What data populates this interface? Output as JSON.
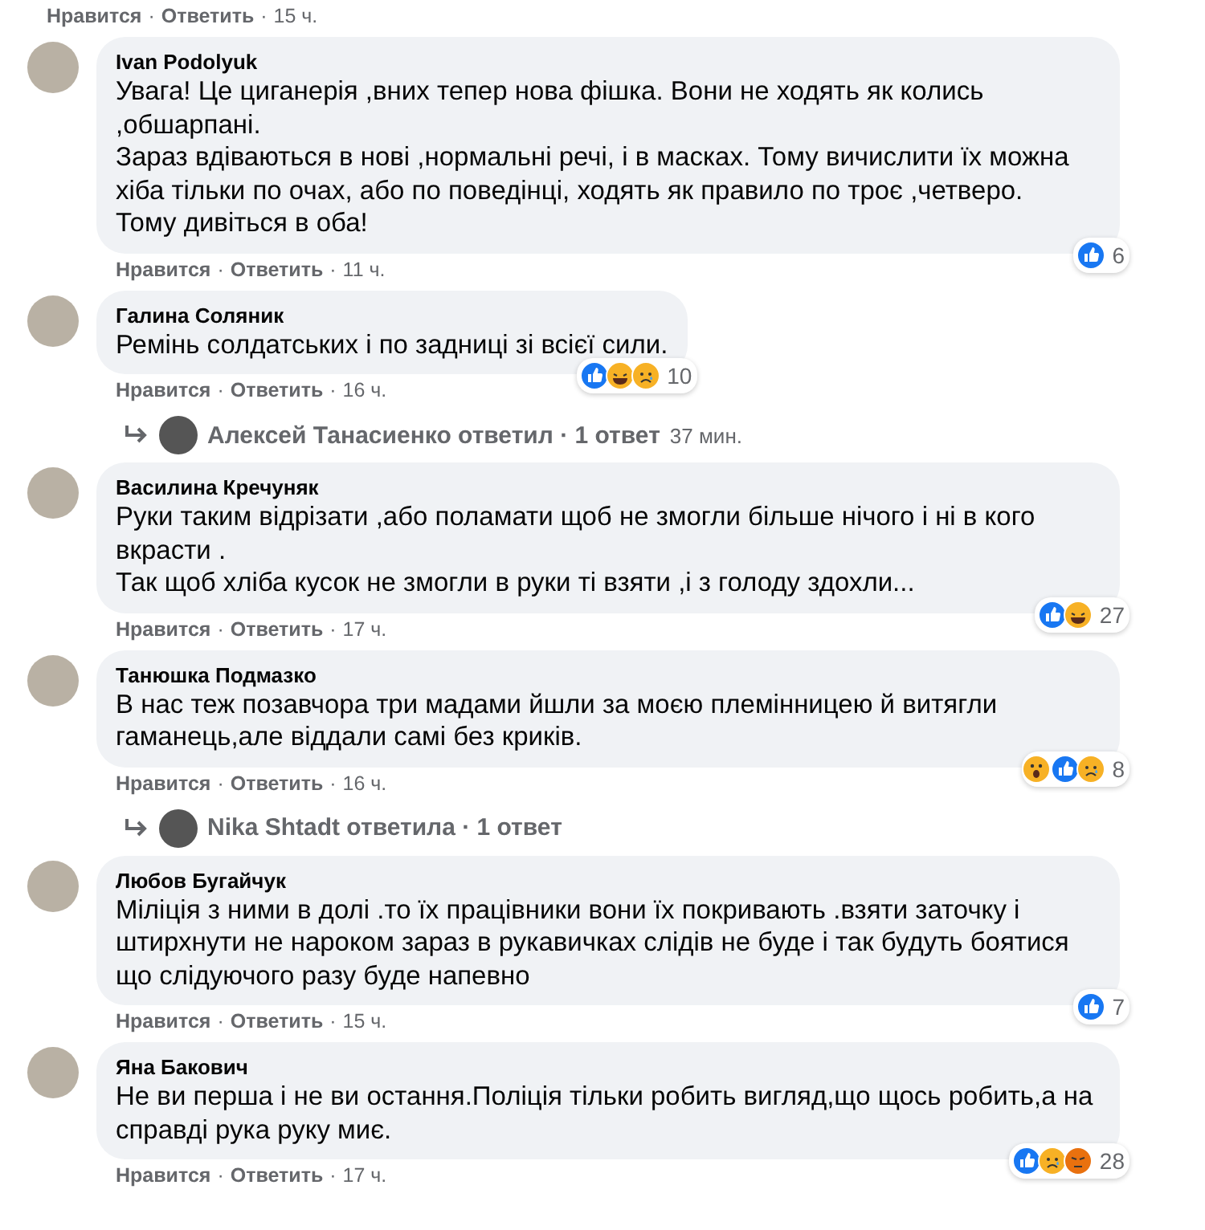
{
  "top_actions": {
    "like": "Нравится",
    "sep1": "·",
    "reply": "Ответить",
    "sep2": "·",
    "time": "15 ч."
  },
  "items": [
    {
      "kind": "comment",
      "author": "Ivan Podolyuk",
      "paragraphs": [
        "Увага! Це циганерія ,вних тепер нова фішка. Вони не ходять як колись ,обшарпані.",
        "Зараз вдіваються в нові ,нормальні речі, і в масках. Тому вичислити їх можна хіба тільки по очах, або по поведінці, ходять як правило по троє ,четверо.",
        "Тому дивіться в оба!"
      ],
      "reactions": [
        {
          "kind": "like"
        }
      ],
      "count": "6",
      "actions": {
        "like": "Нравится",
        "sep1": "·",
        "reply": "Ответить",
        "sep2": "·",
        "time": "11 ч."
      }
    },
    {
      "kind": "comment",
      "author": "Галина Соляник",
      "paragraphs": [
        "Ремінь солдатських і по задниці зі всієї сили."
      ],
      "reactions": [
        {
          "kind": "like"
        },
        {
          "kind": "haha"
        },
        {
          "kind": "sad"
        }
      ],
      "count": "10",
      "actions": {
        "like": "Нравится",
        "sep1": "·",
        "reply": "Ответить",
        "sep2": "·",
        "time": "16 ч."
      }
    },
    {
      "kind": "replies",
      "text": "Алексей Танасиенко ответил · 1 ответ",
      "time": "37 мин."
    },
    {
      "kind": "comment",
      "author": "Василина Кречуняк",
      "paragraphs": [
        "Руки таким відрізати ,або поламати щоб не змогли більше нічого і ні в кого вкрасти .",
        "Так щоб хліба кусок не змогли в руки ті взяти ,і з голоду здохли..."
      ],
      "reactions": [
        {
          "kind": "like"
        },
        {
          "kind": "haha"
        }
      ],
      "count": "27",
      "actions": {
        "like": "Нравится",
        "sep1": "·",
        "reply": "Ответить",
        "sep2": "·",
        "time": "17 ч."
      }
    },
    {
      "kind": "comment",
      "author": "Танюшка Подмазко",
      "paragraphs": [
        "В нас теж позавчора три мадами йшли за моєю племінницею й витягли гаманець,але віддали самі без криків."
      ],
      "reactions": [
        {
          "kind": "wow"
        },
        {
          "kind": "like"
        },
        {
          "kind": "sad"
        }
      ],
      "count": "8",
      "actions": {
        "like": "Нравится",
        "sep1": "·",
        "reply": "Ответить",
        "sep2": "·",
        "time": "16 ч."
      }
    },
    {
      "kind": "replies",
      "text": "Nika Shtadt ответила · 1 ответ"
    },
    {
      "kind": "comment",
      "author": "Любов Бугайчук",
      "paragraphs": [
        "Міліція з ними в долі .то їх працівники вони їх покривають .взяти заточку і штирхнути не нароком зараз в рукавичках слідів не буде і так будуть боятися що слідуючого разу буде напевно"
      ],
      "reactions": [
        {
          "kind": "like"
        }
      ],
      "count": "7",
      "actions": {
        "like": "Нравится",
        "sep1": "·",
        "reply": "Ответить",
        "sep2": "·",
        "time": "15 ч."
      }
    },
    {
      "kind": "comment",
      "author": "Яна Бакович",
      "paragraphs": [
        "Не ви перша і не ви остання.Поліція тільки робить вигляд,що щось робить,а на справді рука руку миє."
      ],
      "reactions": [
        {
          "kind": "like"
        },
        {
          "kind": "sad"
        },
        {
          "kind": "angry"
        }
      ],
      "count": "28",
      "actions": {
        "like": "Нравится",
        "sep1": "·",
        "reply": "Ответить",
        "sep2": "·",
        "time": "17 ч."
      }
    }
  ]
}
